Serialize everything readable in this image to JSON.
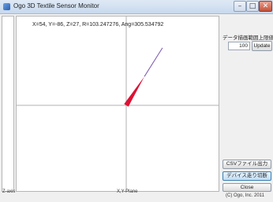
{
  "window": {
    "title": "Ogo 3D Textile Sensor Monitor"
  },
  "plot": {
    "readout": "X=54, Y=-86, Z=27, R=103.247276, Ang=305.534792",
    "z_label": "Z-axis",
    "xy_label": "X,Y-Plane",
    "z_level_fraction": 0.27,
    "vector": {
      "x": 54,
      "y": 86
    },
    "vector_color": "#dd1133",
    "vector_tip_color": "#7a55b0",
    "z_bar_color": "#3d7fe0"
  },
  "controls": {
    "threshold_label": "データ描画範囲上限値",
    "threshold_value": "100",
    "update_button": "Update",
    "csv_button": "CSVファイル出力",
    "device_button": "デバイス走り切断",
    "close_button": "Close"
  },
  "footer": {
    "copyright": "(C) Ogo, Inc. 2011"
  }
}
